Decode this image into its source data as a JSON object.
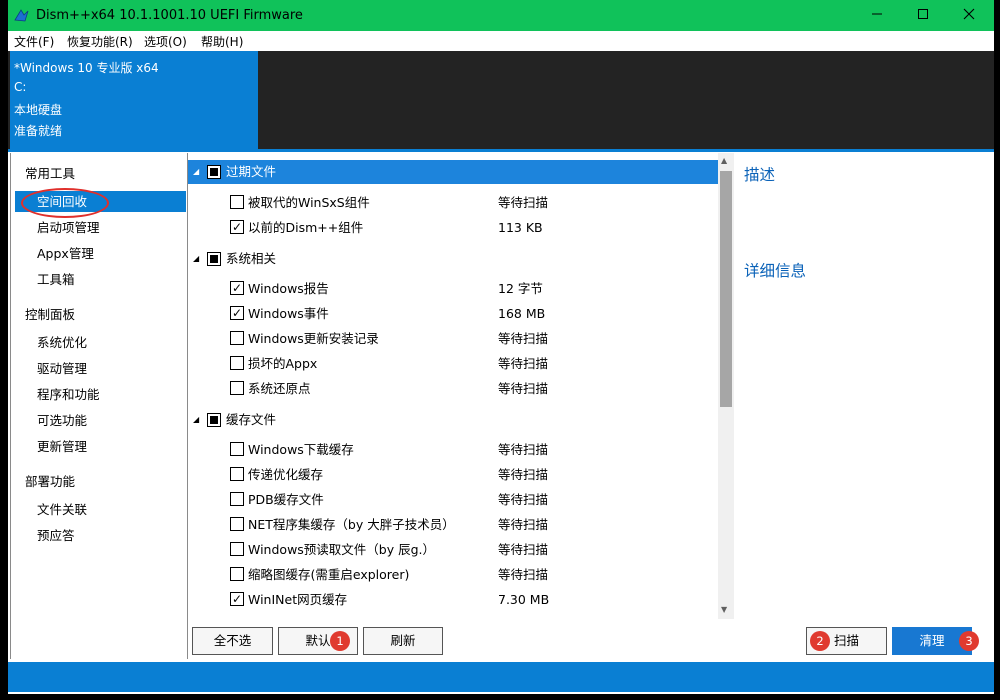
{
  "window": {
    "title": "Dism++x64 10.1.1001.10 UEFI Firmware",
    "accent": "#10c25a",
    "controls": [
      "minimize-icon",
      "maximize-icon",
      "close-icon"
    ]
  },
  "menu": [
    "文件(F)",
    "恢复功能(R)",
    "选项(O)",
    "帮助(H)"
  ],
  "image_info": {
    "name": "*Windows 10 专业版 x64",
    "drive": "C:",
    "disk": "本地硬盘",
    "status": "准备就绪",
    "color": "#0a7fd3"
  },
  "sidebar": {
    "sections": [
      {
        "title": "常用工具",
        "items": [
          "空间回收",
          "启动项管理",
          "Appx管理",
          "工具箱"
        ]
      },
      {
        "title": "控制面板",
        "items": [
          "系统优化",
          "驱动管理",
          "程序和功能",
          "可选功能",
          "更新管理"
        ]
      },
      {
        "title": "部署功能",
        "items": [
          "文件关联",
          "预应答"
        ]
      }
    ],
    "selected": "空间回收"
  },
  "groups": [
    {
      "label": "过期文件",
      "selected": true,
      "items": [
        {
          "label": "被取代的WinSxS组件",
          "status": "等待扫描",
          "checked": false
        },
        {
          "label": "以前的Dism++组件",
          "status": "113 KB",
          "checked": true
        }
      ]
    },
    {
      "label": "系统相关",
      "selected": false,
      "items": [
        {
          "label": "Windows报告",
          "status": "12 字节",
          "checked": true
        },
        {
          "label": "Windows事件",
          "status": "168 MB",
          "checked": true
        },
        {
          "label": "Windows更新安装记录",
          "status": "等待扫描",
          "checked": false
        },
        {
          "label": "损坏的Appx",
          "status": "等待扫描",
          "checked": false
        },
        {
          "label": "系统还原点",
          "status": "等待扫描",
          "checked": false
        }
      ]
    },
    {
      "label": "缓存文件",
      "selected": false,
      "items": [
        {
          "label": "Windows下载缓存",
          "status": "等待扫描",
          "checked": false
        },
        {
          "label": "传递优化缓存",
          "status": "等待扫描",
          "checked": false
        },
        {
          "label": "PDB缓存文件",
          "status": "等待扫描",
          "checked": false
        },
        {
          "label": "NET程序集缓存（by 大胖子技术员）",
          "status": "等待扫描",
          "checked": false
        },
        {
          "label": "Windows预读取文件（by 辰g.）",
          "status": "等待扫描",
          "checked": false
        },
        {
          "label": "缩略图缓存(需重启explorer)",
          "status": "等待扫描",
          "checked": false
        },
        {
          "label": "WinINet网页缓存",
          "status": "7.30 MB",
          "checked": true
        }
      ]
    }
  ],
  "details": {
    "description_label": "描述",
    "details_label": "详细信息"
  },
  "buttons": {
    "deselect_all": "全不选",
    "default": "默认",
    "refresh": "刷新",
    "scan": "扫描",
    "clean": "清理"
  },
  "badges": {
    "default": "1",
    "scan": "2",
    "clean": "3",
    "color": "#e03a2f"
  }
}
